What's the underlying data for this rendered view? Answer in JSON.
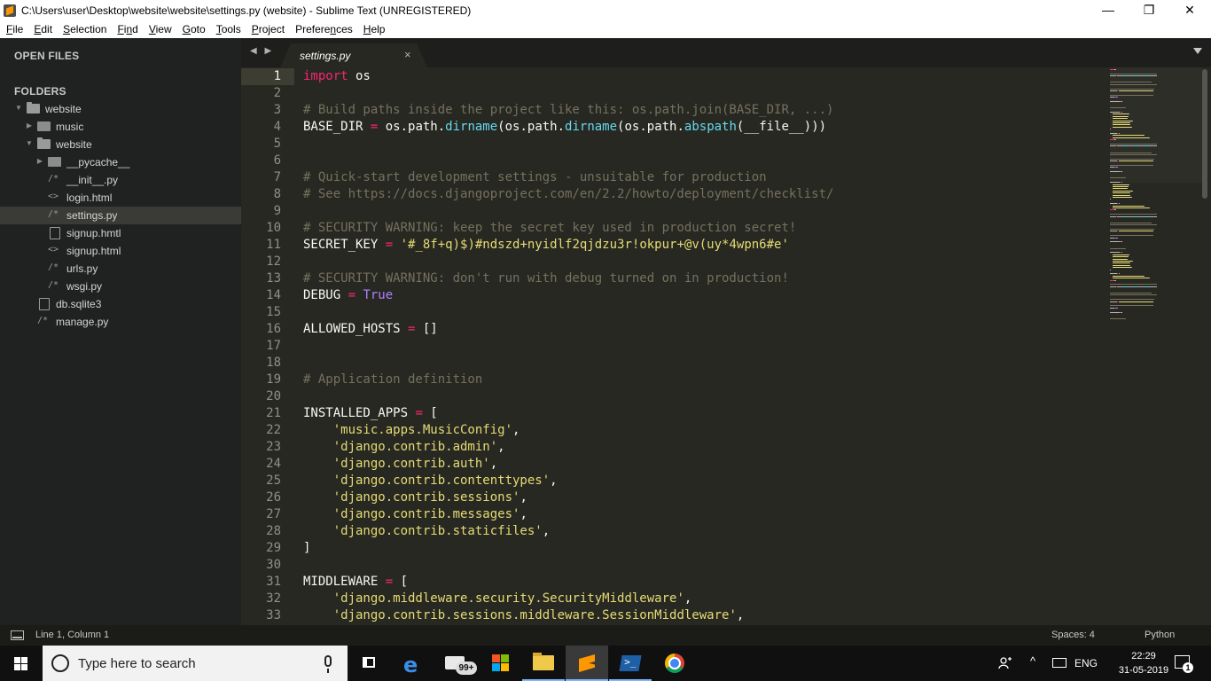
{
  "window": {
    "title": "C:\\Users\\user\\Desktop\\website\\website\\settings.py (website) - Sublime Text (UNREGISTERED)",
    "minimize_glyph": "—",
    "maximize_glyph": "❐",
    "close_glyph": "✕"
  },
  "menu": [
    {
      "first": "F",
      "rest": "ile"
    },
    {
      "first": "E",
      "rest": "dit"
    },
    {
      "first": "S",
      "rest": "election"
    },
    {
      "first": "F",
      "rest": "i",
      "rest_u": "n",
      "rest2": "d"
    },
    {
      "first": "V",
      "rest": "iew"
    },
    {
      "first": "G",
      "rest": "oto"
    },
    {
      "first": "T",
      "rest": "ools"
    },
    {
      "first": "P",
      "rest": "roject"
    },
    {
      "first": "",
      "rest": "Prefere",
      "rest_u": "n",
      "rest2": "ces"
    },
    {
      "first": "H",
      "rest": "elp"
    }
  ],
  "sidebar": {
    "open_files_label": "OPEN FILES",
    "folders_label": "FOLDERS",
    "tree": [
      {
        "name": "website",
        "kind": "folder-open",
        "arrow": "▼",
        "depth": 0
      },
      {
        "name": "music",
        "kind": "folder",
        "arrow": "▶",
        "depth": 1
      },
      {
        "name": "website",
        "kind": "folder-open",
        "arrow": "▼",
        "depth": 1
      },
      {
        "name": "__pycache__",
        "kind": "folder",
        "arrow": "▶",
        "depth": 2
      },
      {
        "name": "__init__.py",
        "kind": "file",
        "glyph": "/*",
        "depth": 2
      },
      {
        "name": "login.html",
        "kind": "file",
        "glyph": "<>",
        "depth": 2
      },
      {
        "name": "settings.py",
        "kind": "file",
        "glyph": "/*",
        "depth": 2,
        "selected": true
      },
      {
        "name": "signup.hmtl",
        "kind": "file-plain",
        "depth": 2
      },
      {
        "name": "signup.html",
        "kind": "file",
        "glyph": "<>",
        "depth": 2
      },
      {
        "name": "urls.py",
        "kind": "file",
        "glyph": "/*",
        "depth": 2
      },
      {
        "name": "wsgi.py",
        "kind": "file",
        "glyph": "/*",
        "depth": 2
      },
      {
        "name": "db.sqlite3",
        "kind": "file-plain",
        "depth": 1
      },
      {
        "name": "manage.py",
        "kind": "file",
        "glyph": "/*",
        "depth": 1
      }
    ]
  },
  "tabs": {
    "nav_arrows": "◀ ▶",
    "active_tab": {
      "label": "settings.py",
      "close_glyph": "×"
    }
  },
  "editor": {
    "current_line": 1,
    "lines": [
      [
        [
          "kw",
          "import"
        ],
        [
          "tx",
          " os"
        ]
      ],
      [],
      [
        [
          "cm",
          "# Build paths inside the project like this: os.path.join(BASE_DIR, ...)"
        ]
      ],
      [
        [
          "tx",
          "BASE_DIR "
        ],
        [
          "op",
          "="
        ],
        [
          "tx",
          " os.path."
        ],
        [
          "fn",
          "dirname"
        ],
        [
          "tx",
          "(os.path."
        ],
        [
          "fn",
          "dirname"
        ],
        [
          "tx",
          "(os.path."
        ],
        [
          "fn",
          "abspath"
        ],
        [
          "tx",
          "(__file__)))"
        ]
      ],
      [],
      [],
      [
        [
          "cm",
          "# Quick-start development settings - unsuitable for production"
        ]
      ],
      [
        [
          "cm",
          "# See https://docs.djangoproject.com/en/2.2/howto/deployment/checklist/"
        ]
      ],
      [],
      [
        [
          "cm",
          "# SECURITY WARNING: keep the secret key used in production secret!"
        ]
      ],
      [
        [
          "tx",
          "SECRET_KEY "
        ],
        [
          "op",
          "="
        ],
        [
          "tx",
          " "
        ],
        [
          "st",
          "'#_8f+q)$)#ndszd+nyidlf2qjdzu3r!okpur+@v(uy*4wpn6#e'"
        ]
      ],
      [],
      [
        [
          "cm",
          "# SECURITY WARNING: don't run with debug turned on in production!"
        ]
      ],
      [
        [
          "tx",
          "DEBUG "
        ],
        [
          "op",
          "="
        ],
        [
          "tx",
          " "
        ],
        [
          "cs",
          "True"
        ]
      ],
      [],
      [
        [
          "tx",
          "ALLOWED_HOSTS "
        ],
        [
          "op",
          "="
        ],
        [
          "tx",
          " []"
        ]
      ],
      [],
      [],
      [
        [
          "cm",
          "# Application definition"
        ]
      ],
      [],
      [
        [
          "tx",
          "INSTALLED_APPS "
        ],
        [
          "op",
          "="
        ],
        [
          "tx",
          " ["
        ]
      ],
      [
        [
          "tx",
          "    "
        ],
        [
          "st",
          "'music.apps.MusicConfig'"
        ],
        [
          "tx",
          ","
        ]
      ],
      [
        [
          "tx",
          "    "
        ],
        [
          "st",
          "'django.contrib.admin'"
        ],
        [
          "tx",
          ","
        ]
      ],
      [
        [
          "tx",
          "    "
        ],
        [
          "st",
          "'django.contrib.auth'"
        ],
        [
          "tx",
          ","
        ]
      ],
      [
        [
          "tx",
          "    "
        ],
        [
          "st",
          "'django.contrib.contenttypes'"
        ],
        [
          "tx",
          ","
        ]
      ],
      [
        [
          "tx",
          "    "
        ],
        [
          "st",
          "'django.contrib.sessions'"
        ],
        [
          "tx",
          ","
        ]
      ],
      [
        [
          "tx",
          "    "
        ],
        [
          "st",
          "'django.contrib.messages'"
        ],
        [
          "tx",
          ","
        ]
      ],
      [
        [
          "tx",
          "    "
        ],
        [
          "st",
          "'django.contrib.staticfiles'"
        ],
        [
          "tx",
          ","
        ]
      ],
      [
        [
          "tx",
          "]"
        ]
      ],
      [],
      [
        [
          "tx",
          "MIDDLEWARE "
        ],
        [
          "op",
          "="
        ],
        [
          "tx",
          " ["
        ]
      ],
      [
        [
          "tx",
          "    "
        ],
        [
          "st",
          "'django.middleware.security.SecurityMiddleware'"
        ],
        [
          "tx",
          ","
        ]
      ],
      [
        [
          "tx",
          "    "
        ],
        [
          "st",
          "'django.contrib.sessions.middleware.SessionMiddleware'"
        ],
        [
          "tx",
          ","
        ]
      ]
    ]
  },
  "statusbar": {
    "position": "Line 1, Column 1",
    "indentation": "Spaces: 4",
    "syntax": "Python"
  },
  "taskbar": {
    "search_placeholder": "Type here to search",
    "mail_badge": "99+",
    "language": "ENG",
    "time": "22:29",
    "date": "31-05-2019",
    "notification_count": "1",
    "chevron": "^"
  },
  "colors": {
    "editor_bg": "#272822",
    "sidebar_bg": "#202121",
    "keyword": "#f92672",
    "comment": "#75715e",
    "string": "#e6db74",
    "function": "#66d9ef",
    "constant": "#ae81ff"
  }
}
